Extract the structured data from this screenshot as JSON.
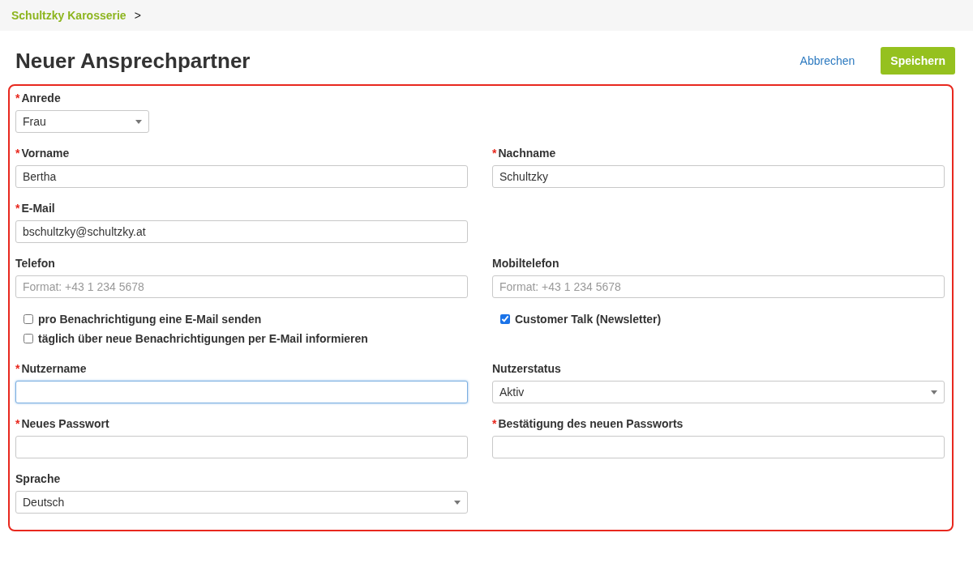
{
  "breadcrumb": {
    "items": [
      {
        "label": "Schultzky Karosserie"
      }
    ],
    "separator": ">"
  },
  "title": "Neuer Ansprechpartner",
  "actions": {
    "cancel": "Abbrechen",
    "save": "Speichern"
  },
  "form": {
    "required_mark": "*",
    "rows": [
      [
        {
          "kind": "small-select",
          "label": "Anrede",
          "required": true,
          "value": "Frau"
        }
      ],
      [
        {
          "kind": "text",
          "label": "Vorname",
          "required": true,
          "value": "Bertha"
        },
        {
          "kind": "text",
          "label": "Nachname",
          "required": true,
          "value": "Schultzky"
        }
      ],
      [
        {
          "kind": "text",
          "label": "E-Mail",
          "required": true,
          "value": "bschultzky@schultzky.at"
        }
      ],
      [
        {
          "kind": "text",
          "label": "Telefon",
          "required": false,
          "placeholder": "Format: +43 1 234 5678"
        },
        {
          "kind": "text",
          "label": "Mobiltelefon",
          "required": false,
          "placeholder": "Format: +43 1 234 5678"
        }
      ],
      [
        {
          "kind": "checkboxes",
          "options": [
            {
              "label": "pro Benachrichtigung eine E-Mail senden",
              "checked": false
            },
            {
              "label": "täglich über neue Benachrichtigungen per E-Mail informieren",
              "checked": false
            }
          ]
        },
        {
          "kind": "checkboxes",
          "options": [
            {
              "label": "Customer Talk (Newsletter)",
              "checked": true
            }
          ]
        }
      ],
      [
        {
          "kind": "text",
          "label": "Nutzername",
          "required": true,
          "focused": true
        },
        {
          "kind": "select",
          "label": "Nutzerstatus",
          "required": false,
          "value": "Aktiv"
        }
      ],
      [
        {
          "kind": "password",
          "label": "Neues Passwort",
          "required": true
        },
        {
          "kind": "password",
          "label": "Bestätigung des neuen Passworts",
          "required": true
        }
      ],
      [
        {
          "kind": "select",
          "label": "Sprache",
          "required": false,
          "value": "Deutsch"
        }
      ]
    ]
  }
}
